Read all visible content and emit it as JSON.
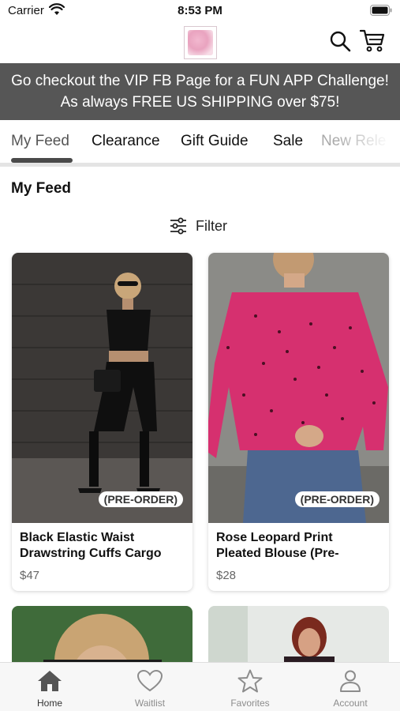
{
  "status_bar": {
    "carrier": "Carrier",
    "time": "8:53 PM"
  },
  "header": {
    "logo_name": "boutique-logo",
    "search_icon": "search-icon",
    "cart_icon": "cart-icon"
  },
  "banner": {
    "line1": "Go checkout the VIP FB Page for a FUN APP Challenge!",
    "line2": "As always FREE US SHIPPING over $75!"
  },
  "tabs": [
    {
      "label": "My Feed",
      "active": true
    },
    {
      "label": "Clearance",
      "active": false
    },
    {
      "label": "Gift Guide",
      "active": false
    },
    {
      "label": "Sale",
      "active": false
    },
    {
      "label": "New Rele",
      "active": false
    }
  ],
  "feed": {
    "title": "My Feed",
    "filter_label": "Filter"
  },
  "products": [
    {
      "badge": "(PRE-ORDER)",
      "name_line1": "Black Elastic Waist",
      "name_line2": "Drawstring Cuffs Cargo",
      "price": "$47"
    },
    {
      "badge": "(PRE-ORDER)",
      "name_line1": "Rose Leopard Print",
      "name_line2": "Pleated Blouse (Pre-",
      "price": "$28"
    }
  ],
  "bottom_nav": [
    {
      "label": "Home",
      "icon": "home-icon",
      "active": true
    },
    {
      "label": "Waitlist",
      "icon": "heart-icon",
      "active": false
    },
    {
      "label": "Favorites",
      "icon": "star-icon",
      "active": false
    },
    {
      "label": "Account",
      "icon": "user-icon",
      "active": false
    }
  ],
  "colors": {
    "banner_bg": "#565656",
    "tab_indicator": "#4a4a4a",
    "brand_pink": "#e9a3bf",
    "blouse_pink": "#d6306f"
  }
}
